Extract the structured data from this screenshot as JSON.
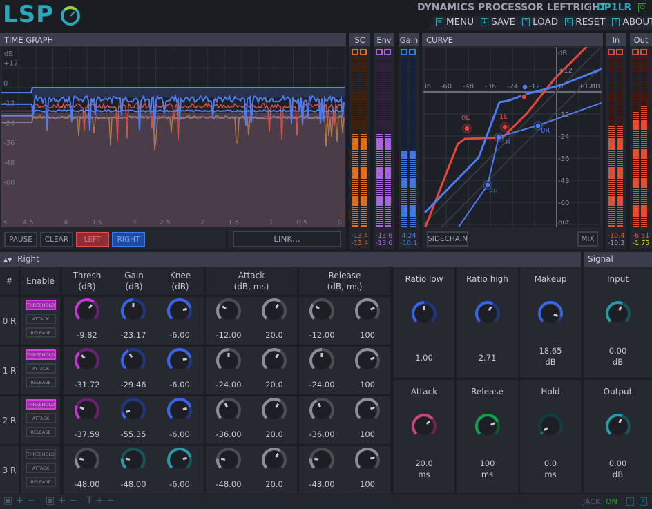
{
  "header": {
    "logo": "LSP",
    "title": "DYNAMICS PROCESSOR LEFTRIGHT",
    "plugin_id": "DP1LR",
    "power_icon": "power-icon",
    "menu": [
      {
        "label": "MENU",
        "icon": "menu-icon"
      },
      {
        "label": "SAVE",
        "icon": "save-icon"
      },
      {
        "label": "LOAD",
        "icon": "load-icon"
      },
      {
        "label": "RESET",
        "icon": "reset-icon"
      },
      {
        "label": "ABOUT",
        "icon": "about-icon"
      }
    ]
  },
  "time_graph": {
    "title": "TIME GRAPH",
    "y_unit": "dB",
    "y_ticks": [
      "+12",
      "0",
      "-12",
      "-24",
      "-36",
      "-48",
      "-60"
    ],
    "x_unit": "s",
    "x_ticks": [
      "4.5",
      "4",
      "3.5",
      "3",
      "2.5",
      "2",
      "1.5",
      "1",
      "0.5",
      "0"
    ],
    "buttons": {
      "pause": "PAUSE",
      "clear": "CLEAR",
      "left": "LEFT",
      "right": "RIGHT",
      "link": "LINK..."
    },
    "colors": {
      "left": "#e8463a",
      "right": "#4f7cf0"
    }
  },
  "meters": {
    "sc": {
      "label": "SC",
      "values": [
        "-13.4",
        "-13.4"
      ],
      "color": "#e07020",
      "level": [
        0.55,
        0.55
      ]
    },
    "env": {
      "label": "Env",
      "values": [
        "-13.6",
        "-13.6"
      ],
      "color": "#b060e8",
      "level": [
        0.55,
        0.55
      ]
    },
    "gain": {
      "label": "Gain",
      "values": [
        "4.24",
        "-10.1"
      ],
      "color": "#3a7ae8",
      "level": [
        0.45,
        0.45
      ]
    },
    "in": {
      "label": "In",
      "values": [
        "-10.4",
        "-10.3"
      ],
      "color": "#e05030",
      "level": [
        0.6,
        0.6
      ]
    },
    "out": {
      "label": "Out",
      "values": [
        "-6.51",
        "-1.75"
      ],
      "color": "#e05030",
      "level": [
        0.68,
        0.72
      ]
    }
  },
  "curve": {
    "title": "CURVE",
    "in_label": "in",
    "out_label": "out",
    "unit": "dB",
    "x_ticks": [
      "-60",
      "-48",
      "-36",
      "-24",
      "-12",
      "0",
      "+12"
    ],
    "y_ticks": [
      "+12",
      "-12",
      "-24",
      "-36",
      "-48",
      "-60"
    ],
    "points": [
      "0L",
      "1L",
      "0R",
      "1R",
      "2R"
    ],
    "buttons": {
      "sidechain": "SIDECHAIN",
      "mix": "MIX"
    }
  },
  "section": {
    "channel": "Right",
    "signal": "Signal"
  },
  "table": {
    "headers": {
      "num": "#",
      "enable": "Enable",
      "thresh": "Thresh\n(dB)",
      "gain": "Gain\n(dB)",
      "knee": "Knee\n(dB)",
      "attack": "Attack\n(dB, ms)",
      "release": "Release\n(dB, ms)"
    },
    "enable_labels": [
      "THRESHOLD",
      "ATTACK",
      "RELEASE"
    ],
    "rows": [
      {
        "id": "0 R",
        "threshold_on": true,
        "thresh": "-9.82",
        "gain": "-23.17",
        "knee": "-6.00",
        "att_db": "-12.00",
        "att_ms": "20.0",
        "rel_db": "-12.00",
        "rel_ms": "100",
        "levels": [
          0.64,
          0.5,
          0.78,
          0.3,
          0.62,
          0.3,
          0.75
        ],
        "colors": [
          "#c03cd0",
          "#3a64e8",
          "#3a64e8",
          "#8a8e98",
          "#8a8e98",
          "#8a8e98",
          "#8a8e98"
        ]
      },
      {
        "id": "1 R",
        "threshold_on": true,
        "thresh": "-31.72",
        "gain": "-29.46",
        "knee": "-6.00",
        "att_db": "-24.00",
        "att_ms": "20.0",
        "rel_db": "-24.00",
        "rel_ms": "100",
        "levels": [
          0.33,
          0.4,
          0.78,
          0.5,
          0.62,
          0.5,
          0.75
        ],
        "colors": [
          "#c03cd0",
          "#3a64e8",
          "#3a64e8",
          "#8a8e98",
          "#8a8e98",
          "#8a8e98",
          "#8a8e98"
        ]
      },
      {
        "id": "2 R",
        "threshold_on": true,
        "thresh": "-37.59",
        "gain": "-55.35",
        "knee": "-6.00",
        "att_db": "-36.00",
        "att_ms": "20.0",
        "rel_db": "-36.00",
        "rel_ms": "100",
        "levels": [
          0.25,
          0.12,
          0.78,
          0.4,
          0.62,
          0.4,
          0.75
        ],
        "colors": [
          "#c03cd0",
          "#3a64e8",
          "#3a64e8",
          "#8a8e98",
          "#8a8e98",
          "#8a8e98",
          "#8a8e98"
        ]
      },
      {
        "id": "3 R",
        "threshold_on": false,
        "thresh": "-48.00",
        "gain": "-48.00",
        "knee": "-6.00",
        "att_db": "-48.00",
        "att_ms": "20.0",
        "rel_db": "-48.00",
        "rel_ms": "100",
        "levels": [
          0.2,
          0.2,
          0.78,
          0.2,
          0.62,
          0.2,
          0.75
        ],
        "colors": [
          "#8a8e98",
          "#2a9aa8",
          "#2a9aa8",
          "#8a8e98",
          "#8a8e98",
          "#8a8e98",
          "#8a8e98"
        ]
      }
    ]
  },
  "controls": [
    {
      "label": "Ratio low",
      "value": "1.00",
      "unit": "",
      "level": 0.5,
      "color": "#3a64e8"
    },
    {
      "label": "Ratio high",
      "value": "2.71",
      "unit": "",
      "level": 0.6,
      "color": "#3a64e8"
    },
    {
      "label": "Makeup",
      "value": "18.65",
      "unit": "dB",
      "level": 0.9,
      "color": "#3a64e8"
    },
    {
      "label": "Input",
      "value": "0.00",
      "unit": "dB",
      "level": 0.58,
      "color": "#2a9aa8"
    },
    {
      "label": "Attack",
      "value": "20.0",
      "unit": "ms",
      "level": 0.68,
      "color": "#c84878"
    },
    {
      "label": "Release",
      "value": "100",
      "unit": "ms",
      "level": 0.75,
      "color": "#10a050"
    },
    {
      "label": "Hold",
      "value": "0.0",
      "unit": "ms",
      "level": 0.05,
      "color": "#1e7078"
    },
    {
      "label": "Output",
      "value": "0.00",
      "unit": "dB",
      "level": 0.58,
      "color": "#2a9aa8"
    }
  ],
  "footer": {
    "jack_label": "JACK:",
    "jack_status": "ON",
    "icons": [
      "window-size-icon",
      "window-size-2-icon",
      "font-size-icon",
      "help-icon",
      "resize-icon"
    ]
  }
}
